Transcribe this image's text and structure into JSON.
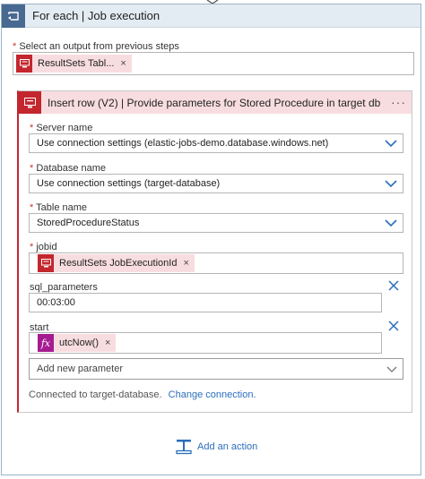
{
  "foreach": {
    "title": "For each | Job execution",
    "outputs_label": "Select an output from previous steps",
    "outputs_token": "ResultSets Tabl..."
  },
  "action": {
    "title": "Insert row (V2) | Provide parameters for Stored Procedure in target db",
    "more": "···",
    "server": {
      "label": "Server name",
      "value": "Use connection settings (elastic-jobs-demo.database.windows.net)"
    },
    "database": {
      "label": "Database name",
      "value": "Use connection settings (target-database)"
    },
    "table": {
      "label": "Table name",
      "value": "StoredProcedureStatus"
    },
    "jobid": {
      "label": "jobid",
      "token": "ResultSets JobExecutionId"
    },
    "sql_parameters": {
      "label": "sql_parameters",
      "value": "00:03:00"
    },
    "start": {
      "label": "start",
      "fx": "fx",
      "token": "utcNow()"
    },
    "add_param": {
      "placeholder": "Add new parameter"
    },
    "connection": {
      "text": "Connected to target-database.",
      "link": "Change connection."
    }
  },
  "add_action": {
    "label": "Add an action"
  },
  "common": {
    "required_mark": "*",
    "remove": "×"
  },
  "colors": {
    "accent": "#2a6ebb",
    "sql_red": "#c4262e",
    "token_bg": "#f8dde0",
    "foreach_blue": "#486991",
    "fx_purple": "#a51c91"
  }
}
